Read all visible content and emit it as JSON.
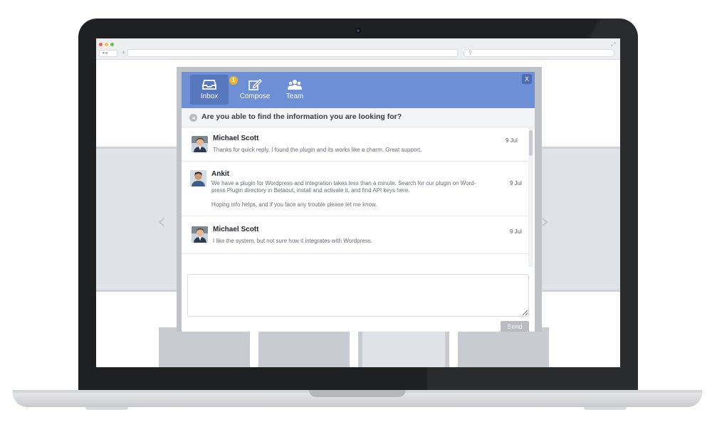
{
  "widget": {
    "tabs": [
      {
        "label": "Inbox",
        "icon": "inbox-icon",
        "active": true,
        "badge": "1"
      },
      {
        "label": "Compose",
        "icon": "compose-icon",
        "active": false
      },
      {
        "label": "Team",
        "icon": "team-icon",
        "active": false
      }
    ],
    "close_label": "X",
    "subject": "Are you able to find the information you are looking for?",
    "messages": [
      {
        "sender": "Michael Scott",
        "body": "Thanks for quick reply. I found the plugin and its works like a charm. Great support.",
        "date": "9 Jul"
      },
      {
        "sender": "Ankit",
        "body": "We have a plugin for Wordpress and integration takes less than a minute. Search for our plugin on Word-\npress Plugin directory in Betaout, install and activate it, and find API keys here.\n\nHoping info helps, and if you face any trouble please let me know.",
        "date": "9 Jul"
      },
      {
        "sender": "Michael Scott",
        "body": "I like the system, but not sure how it integrates with Wordpress.",
        "date": "9 Jul"
      }
    ],
    "reply_placeholder": "",
    "send_label": "Send"
  },
  "colors": {
    "header": "#6c8fd5",
    "active_tab": "#5878bd",
    "badge": "#f0b429",
    "send_button": "#b9bcc1"
  }
}
